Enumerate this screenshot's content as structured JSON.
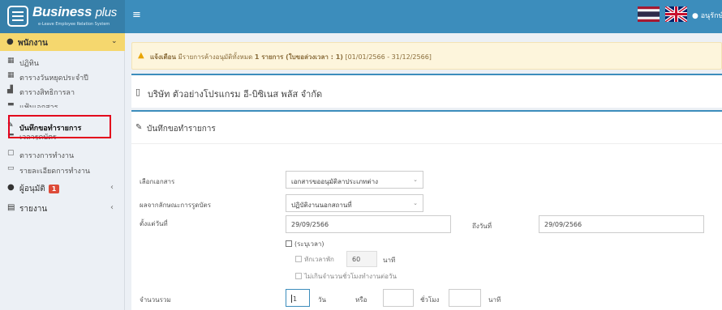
{
  "header": {
    "brand": "Business",
    "brand_suffix": "plus",
    "tagline": "e-Leave Employee Relation System",
    "menu_icon": "≡",
    "user_name": "อนุรักษ์ หวีสัจ",
    "user_icon": "user-icon"
  },
  "sidebar": {
    "header": {
      "icon": "user-icon",
      "label": "พนักงาน"
    },
    "items": [
      {
        "icon": "calendar-icon",
        "label": "ปฏิทิน"
      },
      {
        "icon": "calendar-icon",
        "label": "ตารางวันหยุดประจำปี"
      },
      {
        "icon": "chart-icon",
        "label": "ตารางสิทธิการลา"
      },
      {
        "icon": "folder-icon",
        "label": "แฟ้มเอกสาร"
      },
      {
        "icon": "pencil-icon",
        "label": "บันทึกขอทำรายการ"
      },
      {
        "icon": "clock-icon",
        "label": "เวลารูดบัตร"
      },
      {
        "icon": "table-icon",
        "label": "ตารางการทำงาน"
      },
      {
        "icon": "monitor-icon",
        "label": "รายละเอียดการทำงาน"
      }
    ],
    "sections": [
      {
        "icon": "approver-icon",
        "label": "ผู้อนุมัติ",
        "badge": "1"
      },
      {
        "icon": "report-icon",
        "label": "รายงาน"
      }
    ]
  },
  "alert": {
    "prefix": "แจ้งเตือน",
    "text": "มีรายการค้างอนุมัติทั้งหมด",
    "count_text": "1 รายการ (ใบขอล่วงเวลา : 1)",
    "range": "[01/01/2566 - 31/12/2566]"
  },
  "company": {
    "name": "บริษัท ตัวอย่างโปรแกรม อี-บิซิเนส พลัส จำกัด"
  },
  "form": {
    "title": "บันทึกขอทำรายการ",
    "doc_label": "เลือกเอกสาร",
    "doc_value": "เอกสารขออนุมัติลาประเภทต่าง",
    "result_label": "ผลจากลักษณะการรูดบัตร",
    "result_value": "ปฏิบัติงานนอกสถานที่",
    "from_label": "ตั้งแต่วันที่",
    "from_value": "29/09/2566",
    "to_label": "ถึงวันที่",
    "to_value": "29/09/2566",
    "specify_time": "(ระบุเวลา)",
    "deduct_break": "หักเวลาพัก",
    "break_value": "60",
    "minute_unit": "นาที",
    "not_exceed": "ไม่เกินจำนวนชั่วโมงทำงานต่อวัน",
    "total_label": "จำนวนรวม",
    "days_value": "1",
    "day_unit": "วัน",
    "or_text": "หรือ",
    "hours_value": "",
    "hour_unit": "ชั่วโมง",
    "minutes_value": "",
    "minute_unit2": "นาที"
  }
}
